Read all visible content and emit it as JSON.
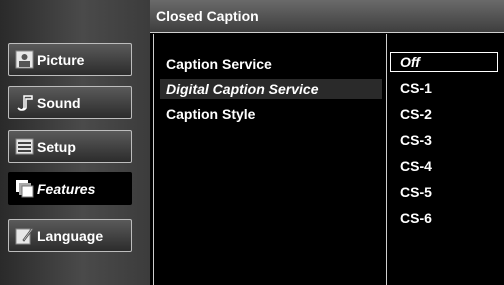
{
  "sidebar": {
    "items": [
      {
        "label": "Picture",
        "icon": "picture-icon"
      },
      {
        "label": "Sound",
        "icon": "sound-icon"
      },
      {
        "label": "Setup",
        "icon": "setup-icon"
      },
      {
        "label": "Features",
        "icon": "features-icon",
        "selected": true
      },
      {
        "label": "Language",
        "icon": "language-icon"
      }
    ]
  },
  "header": {
    "title": "Closed Caption"
  },
  "options": [
    {
      "label": "Caption Service"
    },
    {
      "label": "Digital Caption Service",
      "highlighted": true
    },
    {
      "label": "Caption Style"
    }
  ],
  "values": [
    {
      "label": "Off",
      "selected": true
    },
    {
      "label": "CS-1"
    },
    {
      "label": "CS-2"
    },
    {
      "label": "CS-3"
    },
    {
      "label": "CS-4"
    },
    {
      "label": "CS-5"
    },
    {
      "label": "CS-6"
    }
  ]
}
